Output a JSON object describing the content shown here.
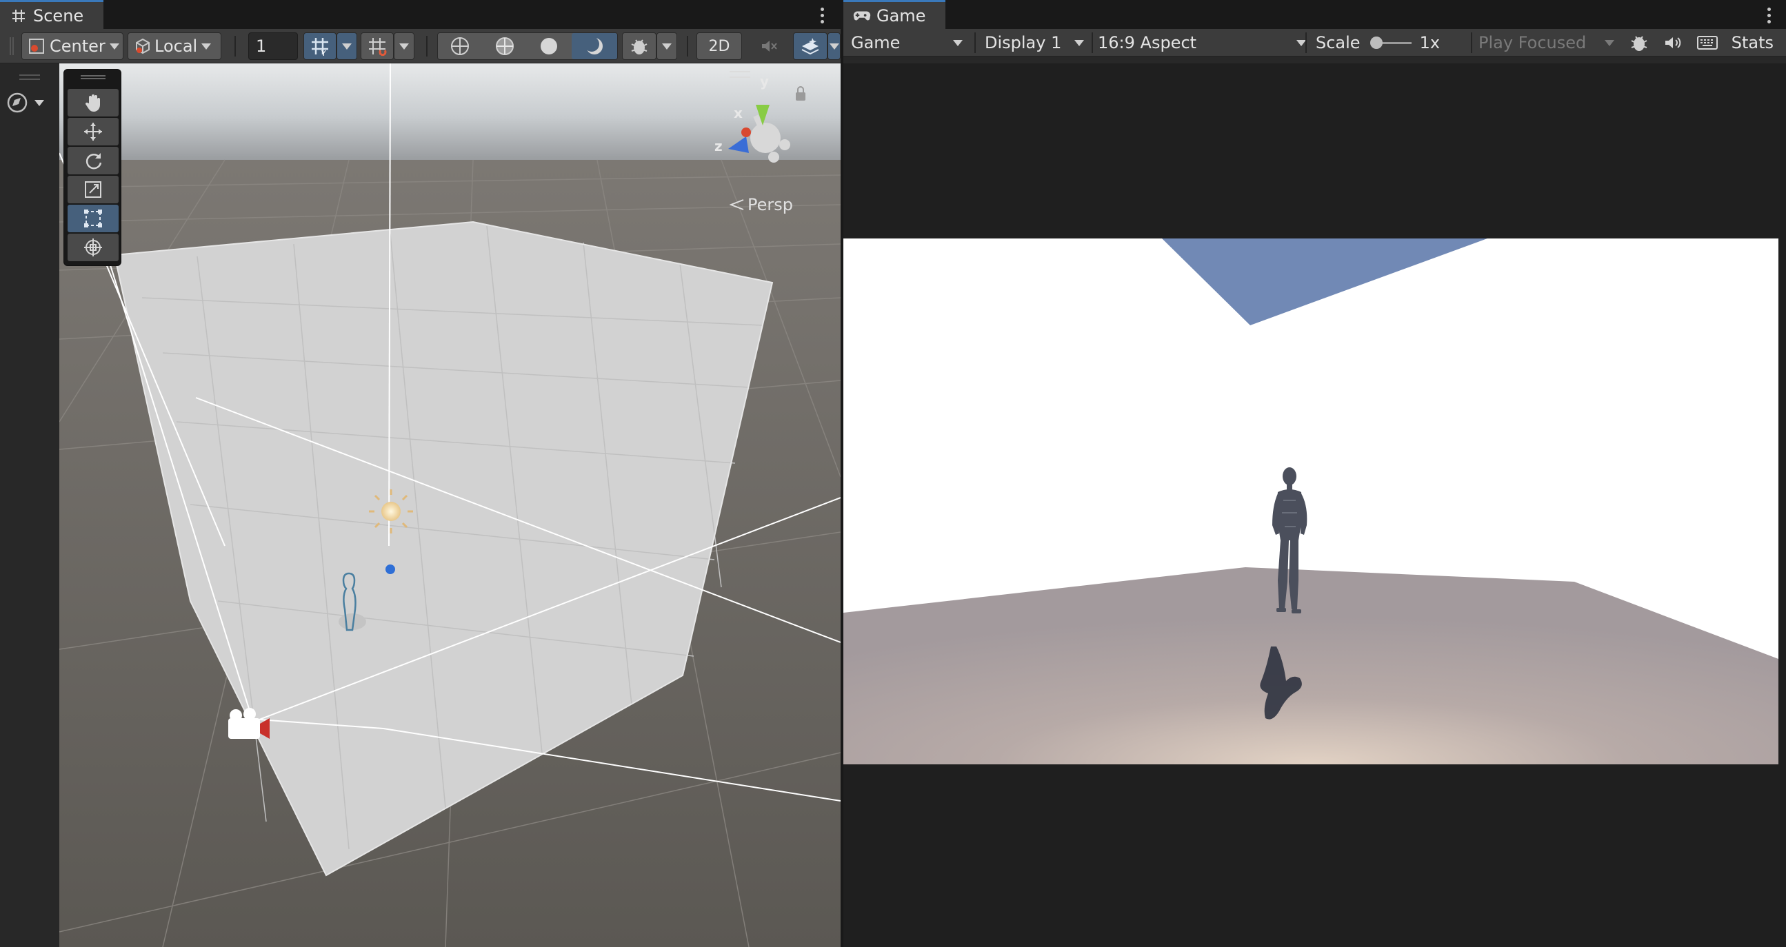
{
  "scene_panel": {
    "tab_label": "Scene",
    "toolbar": {
      "pivot_mode": "Center",
      "pivot_rotation": "Local",
      "grid_size_value": "1",
      "toggle_2d_label": "2D"
    },
    "gizmo": {
      "axis_y": "y",
      "axis_x": "x",
      "axis_z": "z",
      "projection_label": "Persp"
    }
  },
  "game_panel": {
    "tab_label": "Game",
    "toolbar": {
      "view_mode": "Game",
      "display": "Display 1",
      "aspect": "16:9 Aspect",
      "scale_label": "Scale",
      "scale_value": "1x",
      "play_mode": "Play Focused",
      "stats_label": "Stats"
    }
  },
  "colors": {
    "accent_blue": "#3a79bb",
    "selected_button": "#46607c",
    "panel_bg": "#282828",
    "toolbar_bg": "#3c3c3c",
    "sky_plane": "#7189b5"
  },
  "icons": {
    "scene_tab": "hash-grid-icon",
    "game_tab": "gamepad-icon",
    "camera_gizmo": "camera-icon",
    "light_gizmo": "sun-icon"
  }
}
